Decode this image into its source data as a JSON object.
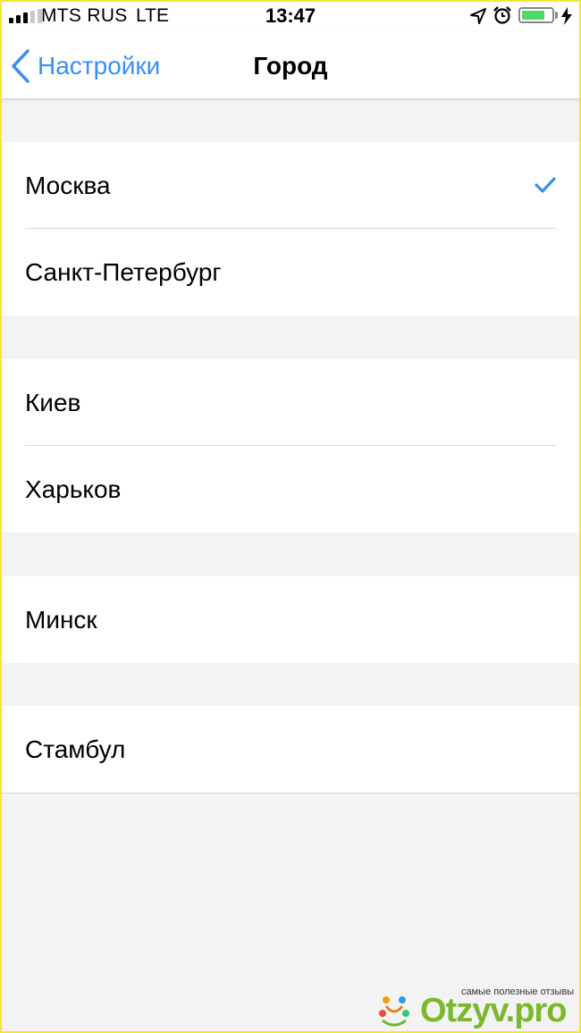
{
  "status_bar": {
    "carrier": "MTS RUS",
    "network": "LTE",
    "time": "13:47",
    "signal_bars_active": 3,
    "signal_bars_total": 5,
    "battery_level": 0.7,
    "icons": [
      "location-arrow-icon",
      "alarm-clock-icon",
      "battery-icon",
      "charging-bolt-icon"
    ]
  },
  "nav": {
    "back_label": "Настройки",
    "title": "Город"
  },
  "groups": [
    {
      "items": [
        {
          "label": "Москва",
          "selected": true
        },
        {
          "label": "Санкт-Петербург",
          "selected": false
        }
      ]
    },
    {
      "items": [
        {
          "label": "Киев",
          "selected": false
        },
        {
          "label": "Харьков",
          "selected": false
        }
      ]
    },
    {
      "items": [
        {
          "label": "Минск",
          "selected": false
        }
      ]
    },
    {
      "items": [
        {
          "label": "Стамбул",
          "selected": false
        }
      ]
    }
  ],
  "watermark": {
    "tagline": "самые полезные отзывы",
    "brand": "Otzyv.pro"
  },
  "colors": {
    "accent": "#3e8ef0",
    "background": "#f3f3f3",
    "battery": "#4cd964",
    "watermark_green": "#7bb82b"
  }
}
